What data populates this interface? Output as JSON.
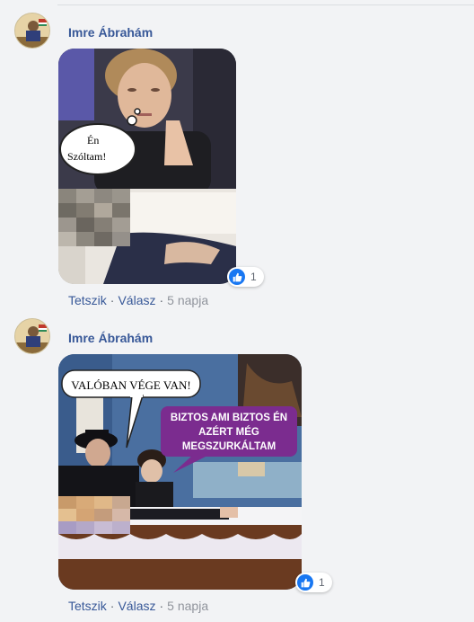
{
  "comments": [
    {
      "author": "Imre Ábrahám",
      "image_text": {
        "bubble_line1": "Én",
        "bubble_line2": "Szóltam!"
      },
      "reaction_count": "1",
      "actions": {
        "like": "Tetszik",
        "reply": "Válasz",
        "time": "5 napja"
      }
    },
    {
      "author": "Imre Ábrahám",
      "image_text": {
        "caption_top": "VALÓBAN VÉGE VAN!",
        "caption_purple_line1": "BIZTOS AMI BIZTOS ÉN",
        "caption_purple_line2": "AZÉRT MÉG",
        "caption_purple_line3": "MEGSZURKÁLTAM"
      },
      "reaction_count": "1",
      "actions": {
        "like": "Tetszik",
        "reply": "Válasz",
        "time": "5 napja"
      }
    }
  ],
  "colors": {
    "link": "#385898",
    "like_blue": "#1877f2",
    "caption_purple": "#7b2c8f"
  }
}
